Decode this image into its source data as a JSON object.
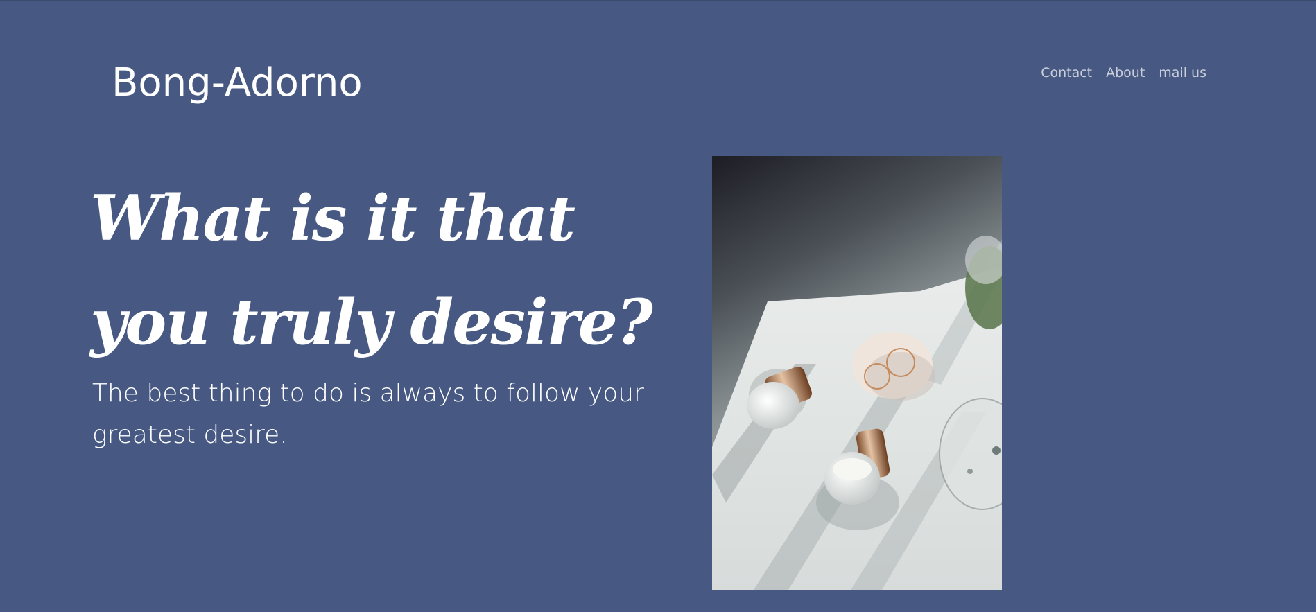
{
  "brand": {
    "name": "Bong-Adorno"
  },
  "nav": {
    "items": [
      {
        "label": "Contact"
      },
      {
        "label": "About"
      },
      {
        "label": "mail us"
      }
    ]
  },
  "hero": {
    "headline": "What is it that you truly desire?",
    "subtitle": "The best thing to do is always to follow your greatest desire."
  },
  "colors": {
    "background": "#475982",
    "text": "#ffffff",
    "nav_text": "#c9cedb"
  }
}
